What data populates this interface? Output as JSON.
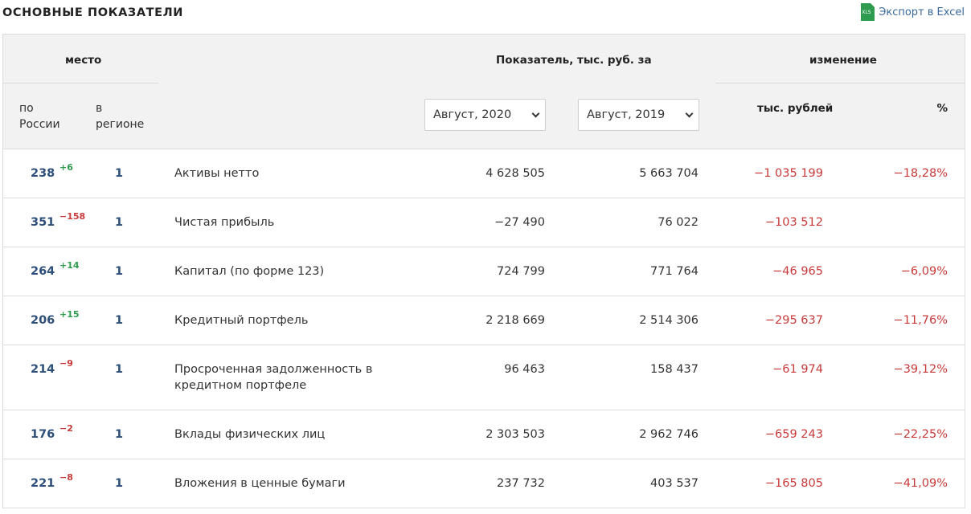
{
  "page_title": "ОСНОВНЫЕ ПОКАЗАТЕЛИ",
  "export": {
    "label": "Экспорт в Excel",
    "icon": "excel-file-icon",
    "icon_text": "XLS"
  },
  "header": {
    "place": "место",
    "indicator": "Показатель, тыс. руб. за",
    "change": "изменение",
    "by_russia": "по России",
    "in_region": "в регионе",
    "thousand_rub": "тыс. рублей",
    "percent": "%"
  },
  "selects": {
    "period1": {
      "value": "Август, 2020"
    },
    "period2": {
      "value": "Август, 2019"
    }
  },
  "rows": [
    {
      "rank": "238",
      "delta": "+6",
      "delta_sign": "pos",
      "region": "1",
      "name": "Активы нетто",
      "v2020": "4 628 505",
      "v2019": "5 663 704",
      "change": "−1 035 199",
      "percent": "−18,28%"
    },
    {
      "rank": "351",
      "delta": "−158",
      "delta_sign": "neg",
      "region": "1",
      "name": "Чистая прибыль",
      "v2020": "−27 490",
      "v2019": "76 022",
      "change": "−103 512",
      "percent": ""
    },
    {
      "rank": "264",
      "delta": "+14",
      "delta_sign": "pos",
      "region": "1",
      "name": "Капитал (по форме 123)",
      "v2020": "724 799",
      "v2019": "771 764",
      "change": "−46 965",
      "percent": "−6,09%"
    },
    {
      "rank": "206",
      "delta": "+15",
      "delta_sign": "pos",
      "region": "1",
      "name": "Кредитный портфель",
      "v2020": "2 218 669",
      "v2019": "2 514 306",
      "change": "−295 637",
      "percent": "−11,76%"
    },
    {
      "rank": "214",
      "delta": "−9",
      "delta_sign": "neg",
      "region": "1",
      "name": "Просроченная задолженность в кредитном портфеле",
      "v2020": "96 463",
      "v2019": "158 437",
      "change": "−61 974",
      "percent": "−39,12%"
    },
    {
      "rank": "176",
      "delta": "−2",
      "delta_sign": "neg",
      "region": "1",
      "name": "Вклады физических лиц",
      "v2020": "2 303 503",
      "v2019": "2 962 746",
      "change": "−659 243",
      "percent": "−22,25%"
    },
    {
      "rank": "221",
      "delta": "−8",
      "delta_sign": "neg",
      "region": "1",
      "name": "Вложения в ценные бумаги",
      "v2020": "237 732",
      "v2019": "403 537",
      "change": "−165 805",
      "percent": "−41,09%"
    }
  ]
}
